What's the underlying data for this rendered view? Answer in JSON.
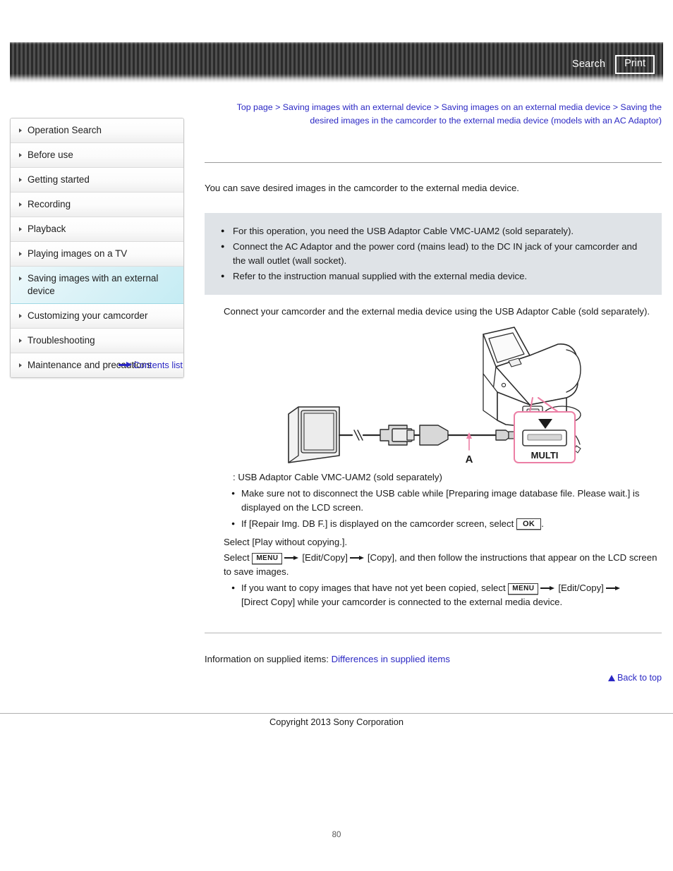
{
  "header": {
    "search_label": "Search",
    "print_label": "Print"
  },
  "breadcrumb": {
    "text": "Top page > Saving images with an external device > Saving images on an external media device > Saving the desired images in the camcorder to the external media device (models with an AC Adaptor)"
  },
  "sidebar": {
    "items": [
      {
        "label": "Operation Search",
        "active": false
      },
      {
        "label": "Before use",
        "active": false
      },
      {
        "label": "Getting started",
        "active": false
      },
      {
        "label": "Recording",
        "active": false
      },
      {
        "label": "Playback",
        "active": false
      },
      {
        "label": "Playing images on a TV",
        "active": false
      },
      {
        "label": "Saving images with an external device",
        "active": true
      },
      {
        "label": "Customizing your camcorder",
        "active": false
      },
      {
        "label": "Troubleshooting",
        "active": false
      },
      {
        "label": "Maintenance and precautions",
        "active": false
      }
    ],
    "contents_list_label": "Contents list"
  },
  "main": {
    "intro": "You can save desired images in the camcorder to the external media device.",
    "notes": [
      "For this operation, you need the USB Adaptor Cable VMC-UAM2 (sold separately).",
      "Connect the AC Adaptor and the power cord (mains lead) to the DC IN jack of your camcorder and the wall outlet (wall socket).",
      "Refer to the instruction manual supplied with the external media device."
    ],
    "step_connect": "Connect your camcorder and the external media device using the USB Adaptor Cable (sold separately).",
    "figure": {
      "callout_label": "MULTI",
      "cable_label": "A",
      "alt": "Camcorder connected to external media device via USB Adaptor Cable into the MULTI connector"
    },
    "figure_caption": ": USB Adaptor Cable VMC-UAM2 (sold separately)",
    "figure_notes": [
      "Make sure not to disconnect the USB cable while [Preparing image database file. Please wait.] is displayed on the LCD screen."
    ],
    "repair_note_before": "If [Repair Img. DB F.] is displayed on the camcorder screen, select ",
    "repair_note_key": "OK",
    "repair_note_after": ".",
    "step_play": "Select [Play without copying.].",
    "step_select_before": "Select ",
    "step_select_key": "MENU",
    "step_select_mid1": "[Edit/Copy]",
    "step_select_mid2": "[Copy], and then follow the instructions that appear on the LCD screen to save images.",
    "direct_copy_before": "If you want to copy images that have not yet been copied, select ",
    "direct_copy_key": "MENU",
    "direct_copy_mid": "[Edit/Copy]",
    "direct_copy_after": "[Direct Copy] while your camcorder is connected to the external media device."
  },
  "footer": {
    "supplied_prefix": "Information on supplied items: ",
    "supplied_link": "Differences in supplied items",
    "back_to_top": "Back to top",
    "copyright": "Copyright 2013 Sony Corporation",
    "page_number": "80"
  },
  "colors": {
    "link": "#2b28c4",
    "notes_bg": "#dfe3e7",
    "active_sidebar": "#c4ecf4",
    "callout_pink": "#e8739c"
  }
}
